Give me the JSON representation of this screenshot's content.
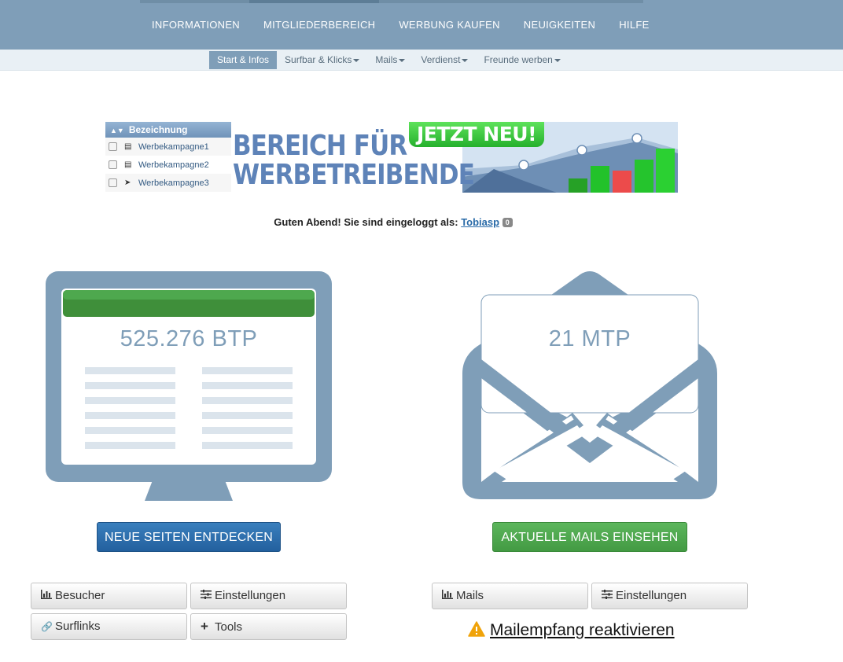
{
  "topnav": {
    "items": [
      "INFORMATIONEN",
      "MITGLIEDERBEREICH",
      "WERBUNG KAUFEN",
      "NEUIGKEITEN",
      "HILFE"
    ],
    "active_index": 1
  },
  "subnav": {
    "items": [
      {
        "label": "Start & Infos",
        "dropdown": false
      },
      {
        "label": "Surfbar & Klicks",
        "dropdown": true
      },
      {
        "label": "Mails",
        "dropdown": true
      },
      {
        "label": "Verdienst",
        "dropdown": true
      },
      {
        "label": "Freunde werben",
        "dropdown": true
      }
    ],
    "active_index": 0
  },
  "banner": {
    "table_header": "Bezeichnung",
    "rows": [
      "Werbekampagne1",
      "Werbekampagne2",
      "Werbekampagne3"
    ],
    "headline_line1": "BEREICH FÜR",
    "headline_line2": "WERBETREIBENDE",
    "badge": "JETZT NEU!"
  },
  "greeting": {
    "text": "Guten Abend! Sie sind eingeloggt als:",
    "username": "Tobiasp",
    "badge": "0"
  },
  "surfbar": {
    "value": "525.276 BTP",
    "button": "NEUE SEITEN ENTDECKEN",
    "actions": [
      {
        "label": "Besucher",
        "icon": "bar-chart-icon"
      },
      {
        "label": "Einstellungen",
        "icon": "sliders-icon"
      },
      {
        "label": "Surflinks",
        "icon": "link-icon"
      },
      {
        "label": "Tools",
        "icon": "plus-icon"
      }
    ]
  },
  "mails": {
    "value": "21 MTP",
    "button": "AKTUELLE MAILS EINSEHEN",
    "actions": [
      {
        "label": "Mails",
        "icon": "bar-chart-icon"
      },
      {
        "label": "Einstellungen",
        "icon": "sliders-icon"
      }
    ],
    "reactivate": "Mailempfang reaktivieren"
  },
  "colors": {
    "nav": "#7f9eb8",
    "illustration": "#7f9eb8",
    "blue_button": "#2c6aa8",
    "green_button": "#4ea84e",
    "warning": "#f0a30a"
  }
}
